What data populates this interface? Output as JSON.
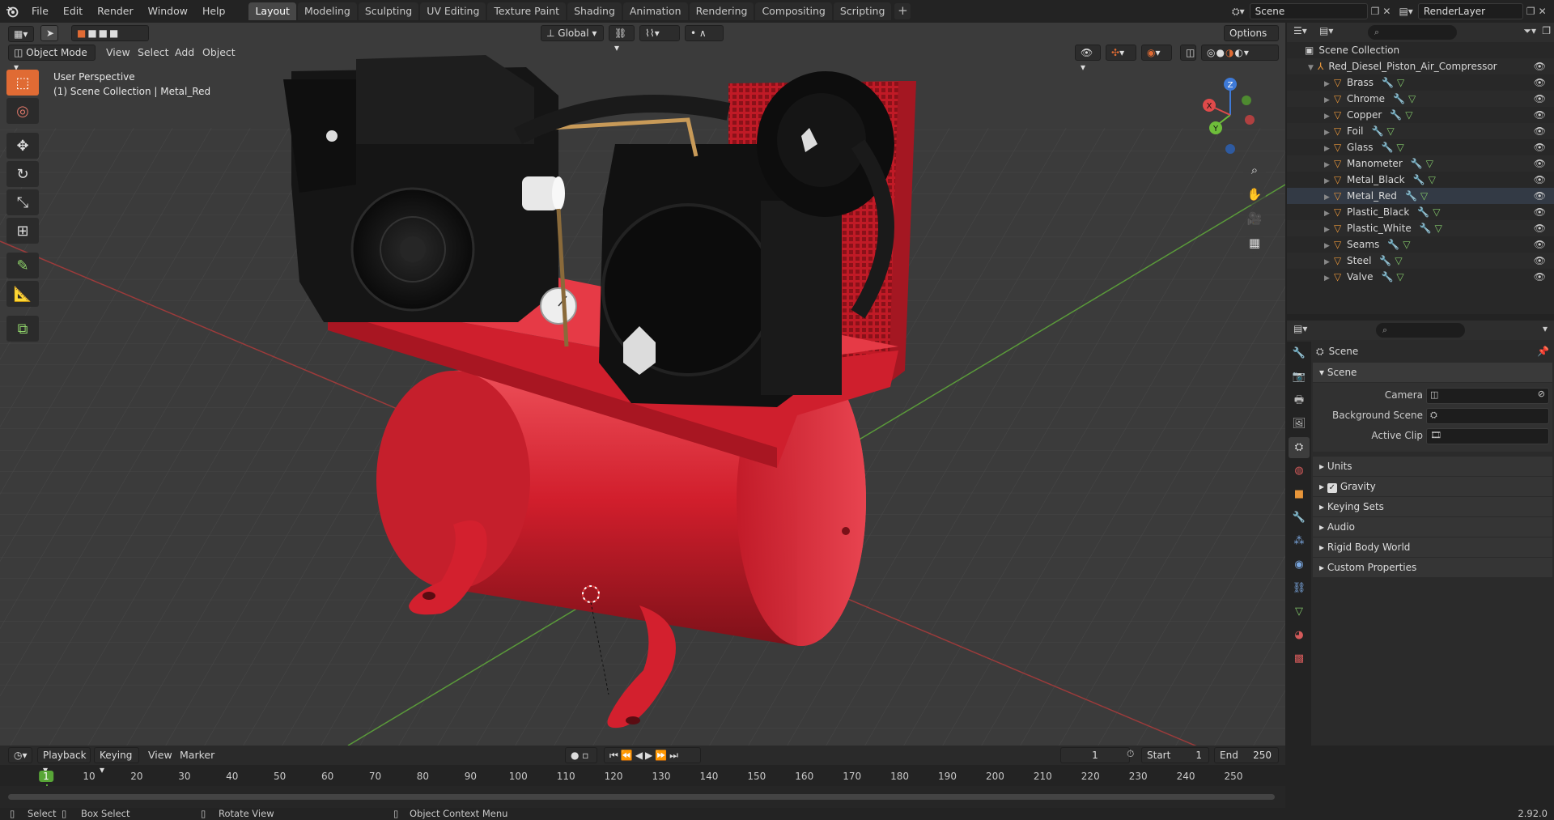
{
  "topbar": {
    "menus": [
      "File",
      "Edit",
      "Render",
      "Window",
      "Help"
    ],
    "workspaces": [
      "Layout",
      "Modeling",
      "Sculpting",
      "UV Editing",
      "Texture Paint",
      "Shading",
      "Animation",
      "Rendering",
      "Compositing",
      "Scripting"
    ],
    "add_workspace": "+",
    "scene_name": "Scene",
    "view_layer": "RenderLayer"
  },
  "viewport": {
    "mode": "Object Mode",
    "menus": [
      "View",
      "Select",
      "Add",
      "Object"
    ],
    "transform_orientation": "Global",
    "options_label": "Options",
    "info_line1": "User Perspective",
    "info_line2": "(1) Scene Collection | Metal_Red",
    "gizmo_axes": {
      "z": "Z",
      "y": "Y",
      "x": "X"
    }
  },
  "outliner": {
    "root": "Scene Collection",
    "collection": "Red_Diesel_Piston_Air_Compressor",
    "items": [
      "Brass",
      "Chrome",
      "Copper",
      "Foil",
      "Glass",
      "Manometer",
      "Metal_Black",
      "Metal_Red",
      "Plastic_Black",
      "Plastic_White",
      "Seams",
      "Steel",
      "Valve"
    ]
  },
  "properties": {
    "context": "Scene",
    "panel_title": "Scene",
    "fields": [
      {
        "label": "Camera"
      },
      {
        "label": "Background Scene"
      },
      {
        "label": "Active Clip"
      }
    ],
    "subpanels": [
      "Units",
      "Gravity",
      "Keying Sets",
      "Audio",
      "Rigid Body World",
      "Custom Properties"
    ]
  },
  "timeline": {
    "menus": [
      "Playback",
      "Keying",
      "View",
      "Marker"
    ],
    "current_frame": "1",
    "start_label": "Start",
    "start_value": "1",
    "end_label": "End",
    "end_value": "250",
    "ticks": [
      "1",
      "10",
      "20",
      "30",
      "40",
      "50",
      "60",
      "70",
      "80",
      "90",
      "100",
      "110",
      "120",
      "130",
      "140",
      "150",
      "160",
      "170",
      "180",
      "190",
      "200",
      "210",
      "220",
      "230",
      "240",
      "250"
    ]
  },
  "statusbar": {
    "select": "Select",
    "box_select": "Box Select",
    "rotate_view": "Rotate View",
    "context_menu": "Object Context Menu",
    "version": "2.92.0"
  },
  "colors": {
    "accent": "#4772b3",
    "active_tool": "#e06b34",
    "body_red": "#d7202e",
    "frame_green": "#58a637"
  }
}
